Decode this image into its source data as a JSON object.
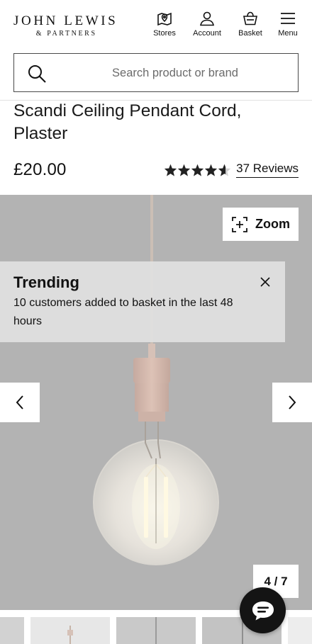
{
  "header": {
    "logo_main": "JOHN LEWIS",
    "logo_sub": "& PARTNERS",
    "nav": [
      {
        "label": "Stores",
        "icon": "store-map-icon"
      },
      {
        "label": "Account",
        "icon": "account-icon"
      },
      {
        "label": "Basket",
        "icon": "basket-icon"
      },
      {
        "label": "Menu",
        "icon": "menu-icon"
      }
    ]
  },
  "search": {
    "placeholder": "Search product or brand",
    "value": "",
    "icon": "search-icon"
  },
  "product": {
    "title": "Scandi Ceiling Pendant Cord, Plaster",
    "price": "£20.00",
    "rating": 4.5,
    "rating_max": 5,
    "reviews_label": "37 Reviews"
  },
  "gallery": {
    "zoom_label": "Zoom",
    "counter": "4 / 7",
    "current_image": 4,
    "total_images": 7,
    "background": "#b3b3b3"
  },
  "trending": {
    "title": "Trending",
    "text": "10 customers added to basket in the last 48 hours"
  },
  "colors": {
    "text": "#111111",
    "gallery_bg": "#b3b3b3",
    "chat_bg": "#141414"
  }
}
